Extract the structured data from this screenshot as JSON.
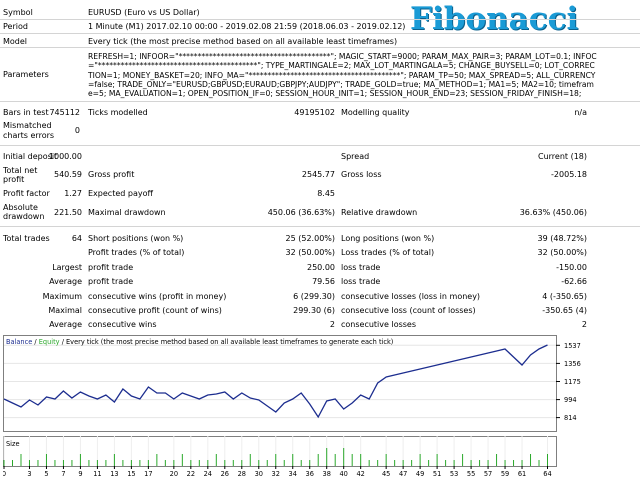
{
  "logo": "Fibonacci",
  "rows": {
    "symbol": {
      "label": "Symbol",
      "value": "EURUSD (Euro vs US Dollar)"
    },
    "period": {
      "label": "Period",
      "value": "1 Minute (M1) 2017.02.10 00:00 - 2019.02.08 21:59 (2018.06.03 - 2019.02.12)"
    },
    "model": {
      "label": "Model",
      "value": "Every tick (the most precise method based on all available least timeframes)"
    },
    "parameters": {
      "label": "Parameters",
      "value": "REFRESH=1; INFOOR=\"****************************************\"; MAGIC_START=9000; PARAM_MAX_PAIR=3; PARAM_LOT=0.1; INFOC=\"******************************************\"; TYPE_MARTINGALE=2; MAX_LOT_MARTINGALA=5; CHANGE_BUYSELL=0; LOT_CORRECTION=1; MONEY_BASKET=20; INFO_MA=\"****************************************\"; PARAM_TP=50; MAX_SPREAD=5; ALL_CURRENCY=false; TRADE_ONLY=\"EURUSD;GBPUSD;EURAUD;GBPJPY;AUDJPY\"; TRADE_GOLD=true; MA_METHOD=1; MA1=5; MA2=10; timeframe=5; MA_EVALUATION=1; OPEN_POSITION_IF=0; SESSION_HOUR_INIT=1; SESSION_HOUR_END=23; SESSION_FRIDAY_FINISH=18;"
    }
  },
  "stats": {
    "bars_label": "Bars in test",
    "bars": "745112",
    "ticks_label": "Ticks modelled",
    "ticks": "49195102",
    "quality_label": "Modelling quality",
    "quality": "n/a",
    "mismatch_label1": "Mismatched",
    "mismatch_label2": "charts errors",
    "mismatch": "0",
    "deposit_label": "Initial deposit",
    "deposit": "1000.00",
    "spread_label": "Spread",
    "spread": "Current (18)",
    "netprofit_label1": "Total net",
    "netprofit_label2": "profit",
    "netprofit": "540.59",
    "grossprofit_label": "Gross profit",
    "grossprofit": "2545.77",
    "grossloss_label": "Gross loss",
    "grossloss": "-2005.18",
    "pf_label": "Profit factor",
    "pf": "1.27",
    "payoff_label": "Expected payoff",
    "payoff": "8.45",
    "absdd_label1": "Absolute",
    "absdd_label2": "drawdown",
    "absdd": "221.50",
    "maxdd_label": "Maximal drawdown",
    "maxdd": "450.06 (36.63%)",
    "reldd_label": "Relative drawdown",
    "reldd": "36.63% (450.06)",
    "trades_label": "Total trades",
    "trades": "64",
    "short_label": "Short positions (won %)",
    "short": "25 (52.00%)",
    "long_label": "Long positions (won %)",
    "long": "39 (48.72%)",
    "ptrades_label": "Profit trades (% of total)",
    "ptrades": "32 (50.00%)",
    "ltrades_label": "Loss trades (% of total)",
    "ltrades": "32 (50.00%)",
    "largest_label": "Largest",
    "lp_label": "profit trade",
    "lp": "250.00",
    "ll_label": "loss trade",
    "ll": "-150.00",
    "average_label": "Average",
    "ap_label": "profit trade",
    "ap": "79.56",
    "al_label": "loss trade",
    "al": "-62.66",
    "maximum_label": "Maximum",
    "mcw_label": "consecutive wins (profit in money)",
    "mcw": "6 (299.30)",
    "mcl_label": "consecutive losses (loss in money)",
    "mcl": "4 (-350.65)",
    "maximal_label": "Maximal",
    "mcp_label": "consecutive profit (count of wins)",
    "mcp": "299.30 (6)",
    "mclc_label": "consecutive loss (count of losses)",
    "mclc": "-350.65 (4)",
    "average2_label": "Average",
    "acw_label": "consecutive wins",
    "acw": "2",
    "acl_label": "consecutive losses",
    "acl": "2"
  },
  "chart_data": {
    "type": "line",
    "legend_balance": "Balance",
    "legend_sep": " / ",
    "legend_equity": "Equity",
    "legend_rest": " / Every tick (the most precise method based on all available least timeframes to generate each tick)",
    "size_label": "Size",
    "colors": {
      "balance": "#1c2d8f",
      "equity": "#2aa82a",
      "size": "#2aa82a"
    },
    "ylim": [
      680,
      1600
    ],
    "yticks": [
      "1537",
      "1356",
      "1175",
      "994",
      "814"
    ],
    "ytick_values": [
      1537,
      1356,
      1175,
      994,
      814
    ],
    "xticks": [
      "0",
      "3",
      "5",
      "7",
      "9",
      "11",
      "13",
      "15",
      "17",
      "20",
      "22",
      "24",
      "26",
      "28",
      "30",
      "32",
      "34",
      "36",
      "38",
      "40",
      "42",
      "45",
      "47",
      "49",
      "51",
      "53",
      "55",
      "57",
      "59",
      "61",
      "64"
    ],
    "xlim": [
      0,
      65
    ],
    "x": [
      0,
      1,
      2,
      3,
      4,
      5,
      6,
      7,
      8,
      9,
      10,
      11,
      12,
      13,
      14,
      15,
      16,
      17,
      18,
      19,
      20,
      21,
      22,
      23,
      24,
      25,
      26,
      27,
      28,
      29,
      30,
      31,
      32,
      33,
      34,
      35,
      36,
      37,
      38,
      39,
      40,
      41,
      42,
      43,
      44,
      45,
      46,
      47,
      48,
      49,
      50,
      51,
      52,
      53,
      54,
      55,
      56,
      57,
      58,
      59,
      60,
      61,
      62,
      63,
      64
    ],
    "balance": [
      1000,
      960,
      920,
      990,
      940,
      1020,
      1000,
      1080,
      1010,
      1070,
      1030,
      1000,
      1040,
      970,
      1100,
      1030,
      1000,
      1120,
      1060,
      1060,
      1000,
      1060,
      1030,
      1000,
      1040,
      1050,
      1070,
      1000,
      1060,
      1010,
      990,
      930,
      870,
      960,
      1000,
      1060,
      950,
      820,
      980,
      1000,
      900,
      960,
      1040,
      1000,
      1160,
      1220,
      1240,
      1260,
      1280,
      1300,
      1320,
      1340,
      1360,
      1380,
      1400,
      1420,
      1440,
      1460,
      1480,
      1500,
      1420,
      1340,
      1440,
      1500,
      1540
    ],
    "size": [
      1,
      1,
      2,
      1,
      1,
      2,
      1,
      1,
      1,
      2,
      1,
      1,
      1,
      2,
      1,
      1,
      1,
      1,
      2,
      1,
      1,
      2,
      1,
      1,
      1,
      2,
      1,
      1,
      1,
      2,
      1,
      1,
      2,
      1,
      2,
      1,
      1,
      2,
      3,
      2,
      3,
      2,
      2,
      1,
      1,
      2,
      1,
      1,
      1,
      2,
      1,
      2,
      1,
      1,
      2,
      1,
      1,
      1,
      2,
      1,
      1,
      1,
      2,
      1,
      2
    ]
  }
}
